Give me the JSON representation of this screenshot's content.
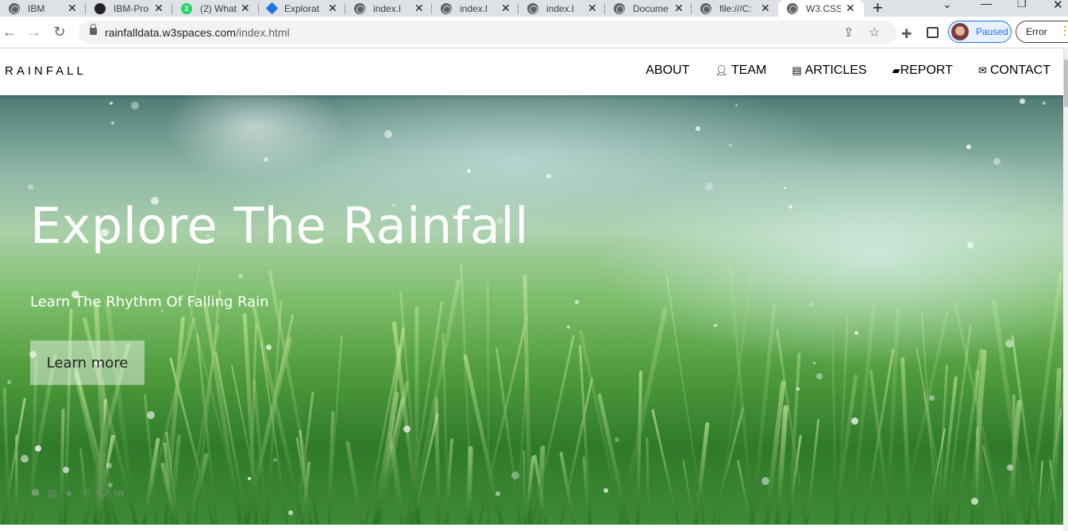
{
  "browser": {
    "tabs": [
      {
        "title": "IBM",
        "icon": "globe-icon"
      },
      {
        "title": "IBM-Pro",
        "icon": "github-icon"
      },
      {
        "title": "(2) What",
        "icon": "whatsapp-icon"
      },
      {
        "title": "Explorat",
        "icon": "diamond-icon"
      },
      {
        "title": "index.htm",
        "icon": "globe-icon"
      },
      {
        "title": "index.htm",
        "icon": "globe-icon"
      },
      {
        "title": "index.htm",
        "icon": "globe-icon"
      },
      {
        "title": "Docume",
        "icon": "globe-icon"
      },
      {
        "title": "file:///C:",
        "icon": "globe-icon"
      },
      {
        "title": "W3.CSS",
        "icon": "globe-icon",
        "active": true
      }
    ],
    "whatsapp_badge": "2",
    "url_host": "rainfalldata.w3spaces.com",
    "url_path": "/index.html",
    "profile_label": "Paused",
    "error_label": "Error"
  },
  "site": {
    "brand": "RAINFALL",
    "nav": [
      {
        "label": "ABOUT",
        "icon": ""
      },
      {
        "label": "TEAM",
        "icon": "user-icon"
      },
      {
        "label": "ARTICLES",
        "icon": "newspaper-icon"
      },
      {
        "label": "REPORT",
        "icon": "book-icon"
      },
      {
        "label": "CONTACT",
        "icon": "envelope-icon"
      }
    ],
    "hero": {
      "title": "Explore The Rainfall",
      "subtitle": "Learn The Rhythm Of Falling Rain",
      "button": "Learn more"
    },
    "social": [
      "facebook-icon",
      "instagram-icon",
      "snapchat-icon",
      "pinterest-icon",
      "twitter-icon",
      "linkedin-icon"
    ]
  },
  "colors": {
    "accent": "#1a73e8",
    "tabstrip": "#dee1e6",
    "hero_green": "#4e9a3c"
  }
}
